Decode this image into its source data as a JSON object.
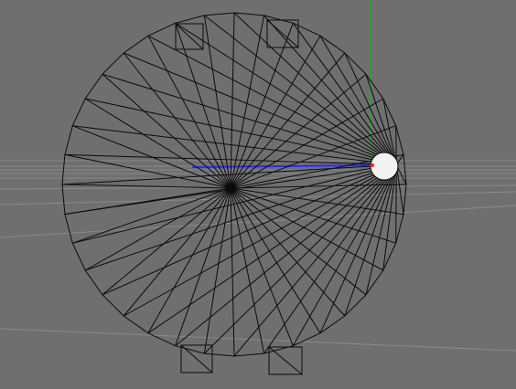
{
  "viewport": {
    "background": "#6f6f6f",
    "grid_color": "#8a8a8a",
    "wire_color": "#0b0b0b",
    "axis_x_color": "#2a2aff",
    "axis_y_color": "#00c800",
    "axis_origin_marker_color": "#ff2a2a",
    "selected_highlight_color": "#f2f2f2"
  },
  "object": {
    "name": "",
    "type_icon": "cylinder-wireframe-icon"
  }
}
